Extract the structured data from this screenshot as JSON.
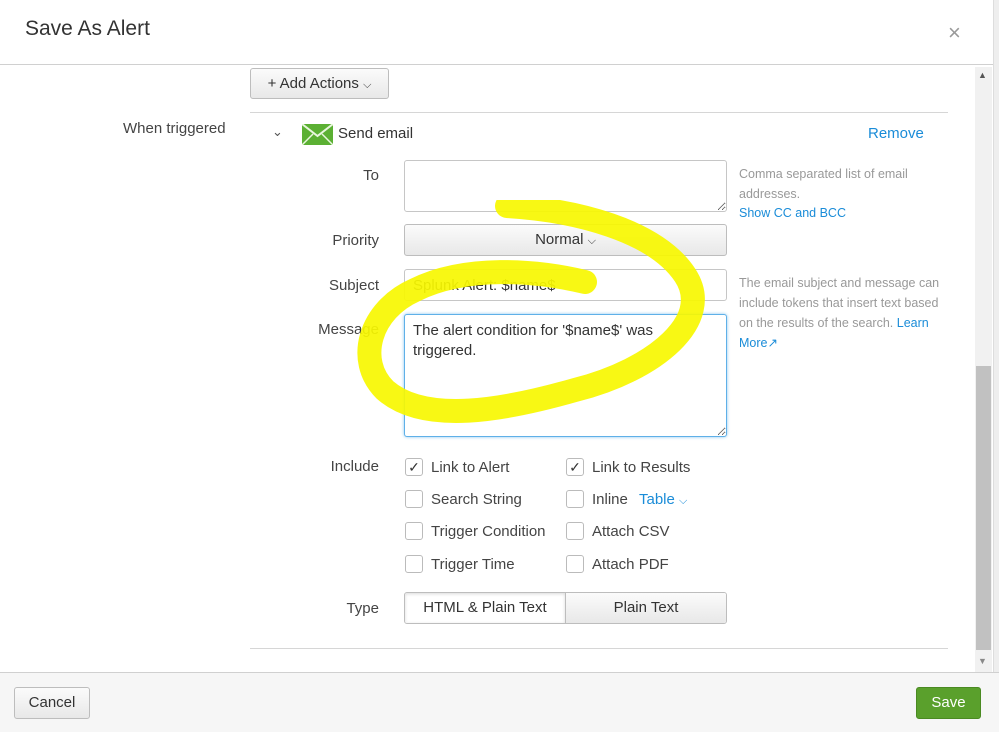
{
  "modal": {
    "title": "Save As Alert",
    "close_glyph": "×"
  },
  "actions": {
    "add_actions_label": "+ Add Actions",
    "chevron": "⌄"
  },
  "trigger": {
    "section_label": "When triggered",
    "action_name": "Send email",
    "remove_label": "Remove"
  },
  "fields": {
    "to": {
      "label": "To",
      "value": "",
      "help": "Comma separated list of email addresses.",
      "show_cc_bcc": "Show CC and BCC"
    },
    "priority": {
      "label": "Priority",
      "value": "Normal"
    },
    "subject": {
      "label": "Subject",
      "value": "Splunk Alert: $name$"
    },
    "message": {
      "label": "Message",
      "value": "The alert condition for '$name$' was triggered."
    },
    "token_help": "The email subject and message can include tokens that insert text based on the results of the search.",
    "learn_more": "Learn More"
  },
  "include": {
    "label": "Include",
    "options": [
      {
        "label": "Link to Alert",
        "checked": true
      },
      {
        "label": "Link to Results",
        "checked": true
      },
      {
        "label": "Search String",
        "checked": false
      },
      {
        "label": "Inline",
        "checked": false
      },
      {
        "label": "Trigger Condition",
        "checked": false
      },
      {
        "label": "Attach CSV",
        "checked": false
      },
      {
        "label": "Trigger Time",
        "checked": false
      },
      {
        "label": "Attach PDF",
        "checked": false
      }
    ],
    "inline_format": "Table"
  },
  "type": {
    "label": "Type",
    "options": [
      "HTML & Plain Text",
      "Plain Text"
    ],
    "selected": "HTML & Plain Text"
  },
  "footer": {
    "cancel_label": "Cancel",
    "save_label": "Save"
  },
  "colors": {
    "save": "#5aa02c",
    "link": "#1a8cd8",
    "highlight": "#f7f700",
    "focus": "#5fb0e8"
  }
}
